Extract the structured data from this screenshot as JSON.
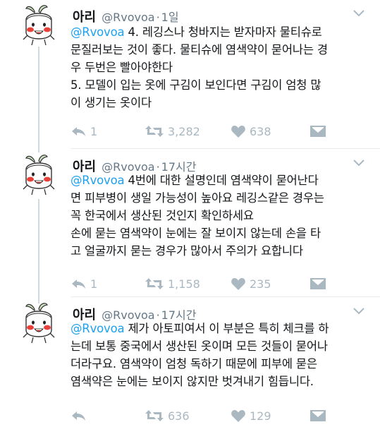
{
  "tweets": [
    {
      "name": "아리",
      "handle": "@Rvovoa",
      "dot": "·",
      "time": "1일",
      "lines": [
        {
          "mention": "@Rvovoa",
          "text": " 4. 레깅스나 청바지는 받자마자 물티슈로"
        },
        {
          "mention": "",
          "text": "문질러보는 것이 좋다. 물티슈에 염색약이 묻어나는 경"
        },
        {
          "mention": "",
          "text": "우 두번은 빨아야한다"
        },
        {
          "mention": "",
          "text": "5. 모델이 입는 옷에 구김이 보인다면 구김이 엄청  많"
        },
        {
          "mention": "",
          "text": "이 생기는 옷이다"
        }
      ],
      "reply_count": "1",
      "retweet_count": "3,282",
      "like_count": "638"
    },
    {
      "name": "아리",
      "handle": "@Rvovoa",
      "dot": "·",
      "time": "17시간",
      "lines": [
        {
          "mention": "@Rvovoa",
          "text": " 4번에 대한 설명인데 염색약이 묻어난다"
        },
        {
          "mention": "",
          "text": "면 피부병이 생일 가능성이 높아요 레깅스같은 경우는"
        },
        {
          "mention": "",
          "text": "꼭 한국에서 생산된 것인지 확인하세요"
        },
        {
          "mention": "",
          "text": "손에 묻는 염색약이 눈에는 잘 보이지 않는데 손을 타"
        },
        {
          "mention": "",
          "text": "고 얼굴까지 묻는 경우가 많아서 주의가 요합니다"
        }
      ],
      "reply_count": "1",
      "retweet_count": "1,158",
      "like_count": "235"
    },
    {
      "name": "아리",
      "handle": "@Rvovoa",
      "dot": "·",
      "time": "17시간",
      "lines": [
        {
          "mention": "@Rvovoa",
          "text": " 제가 아토피여서 이 부분은 특히 체크를 하"
        },
        {
          "mention": "",
          "text": "는데 보통 중국에서 생산된 옷이며 모든 것들이 묻어나"
        },
        {
          "mention": "",
          "text": "더라구요. 염색약이 엄청 독하기 때문에 피부에 묻은"
        },
        {
          "mention": "",
          "text": "염색약은 눈에는 보이지 않지만 벗겨내기 힘듭니다."
        }
      ],
      "reply_count": "",
      "retweet_count": "636",
      "like_count": "129"
    }
  ],
  "icons": {
    "avatar": "radish-character-avatar",
    "caret": "chevron-down-icon",
    "reply": "reply-icon",
    "retweet": "retweet-icon",
    "like": "heart-icon",
    "dm": "envelope-icon"
  },
  "colors": {
    "mention": "#1da1f2",
    "action_gray": "#aab8c2",
    "secondary_text": "#657786",
    "thread_line": "#cfd9de"
  }
}
